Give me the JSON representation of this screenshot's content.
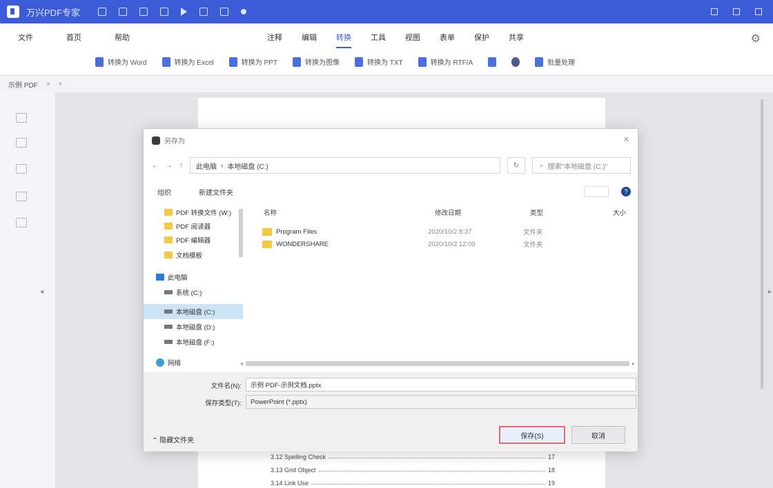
{
  "app": {
    "title": "万兴PDF专家",
    "window_controls": [
      "minimize",
      "maximize",
      "close"
    ]
  },
  "menu": {
    "left": [
      "文件",
      "首页",
      "帮助"
    ],
    "tabs": [
      {
        "label": "注释",
        "active": false
      },
      {
        "label": "编辑",
        "active": false
      },
      {
        "label": "转换",
        "active": true
      },
      {
        "label": "工具",
        "active": false
      },
      {
        "label": "视图",
        "active": false
      },
      {
        "label": "表单",
        "active": false
      },
      {
        "label": "保护",
        "active": false
      },
      {
        "label": "共享",
        "active": false
      }
    ]
  },
  "toolbar": {
    "tools": [
      {
        "label": "转换为 Word",
        "icon": "word-icon"
      },
      {
        "label": "转换为 Excel",
        "icon": "excel-icon"
      },
      {
        "label": "转换为 PPT",
        "icon": "ppt-icon"
      },
      {
        "label": "转换为图像",
        "icon": "image-icon"
      },
      {
        "label": "转换为 TXT",
        "icon": "txt-icon"
      },
      {
        "label": "转换为 RTF/A",
        "icon": "rtf-icon"
      },
      {
        "label": "",
        "icon": "more-icon"
      },
      {
        "label": "",
        "icon": "gear-icon"
      },
      {
        "label": "批量处理",
        "icon": "batch-icon"
      }
    ]
  },
  "file_tab": {
    "label": "示例 PDF"
  },
  "document": {
    "toc": [
      {
        "title": "3.12 Spelling Check",
        "page": "17"
      },
      {
        "title": "3.13 Grid Object",
        "page": "18"
      },
      {
        "title": "3.14 Link Use",
        "page": "19"
      }
    ]
  },
  "dialog": {
    "title": "另存为",
    "address": {
      "path": [
        "此电脑",
        "本地磁盘 (C:)"
      ],
      "search_placeholder": "搜索\"本地磁盘 (C:)\""
    },
    "commandbar": {
      "organize": "组织",
      "new_folder": "新建文件夹"
    },
    "nav": {
      "items": [
        {
          "label": "PDF 转换文件 (W:)",
          "icon": "folder-icon"
        },
        {
          "label": "PDF 阅读器",
          "icon": "folder-icon"
        },
        {
          "label": "PDF 编辑器",
          "icon": "folder-icon"
        },
        {
          "label": "文档模板",
          "icon": "folder-icon"
        },
        {
          "label": "此电脑",
          "icon": "computer-icon"
        },
        {
          "label": "系统 (C:)",
          "icon": "drive-icon"
        },
        {
          "label": "本地磁盘 (C:)",
          "icon": "drive-icon",
          "selected": true
        },
        {
          "label": "本地磁盘 (D:)",
          "icon": "drive-icon"
        },
        {
          "label": "本地磁盘 (F:)",
          "icon": "drive-icon"
        },
        {
          "label": "网络",
          "icon": "network-icon"
        }
      ]
    },
    "filelist": {
      "headers": [
        "名称",
        "修改日期",
        "类型",
        "大小"
      ],
      "rows": [
        {
          "name": "Program Files",
          "date": "2020/10/2 8:37",
          "type": "文件夹"
        },
        {
          "name": "WONDERSHARE",
          "date": "2020/10/2 12:09",
          "type": "文件夹"
        }
      ]
    },
    "fields": {
      "filename_label": "文件名(N):",
      "filename_value": "示例 PDF-示例文档.pptx",
      "type_label": "保存类型(T):",
      "type_value": "PowerPoint (*.pptx)"
    },
    "hide_folders": "隐藏文件夹",
    "save_label": "保存(S)",
    "cancel_label": "取消"
  }
}
